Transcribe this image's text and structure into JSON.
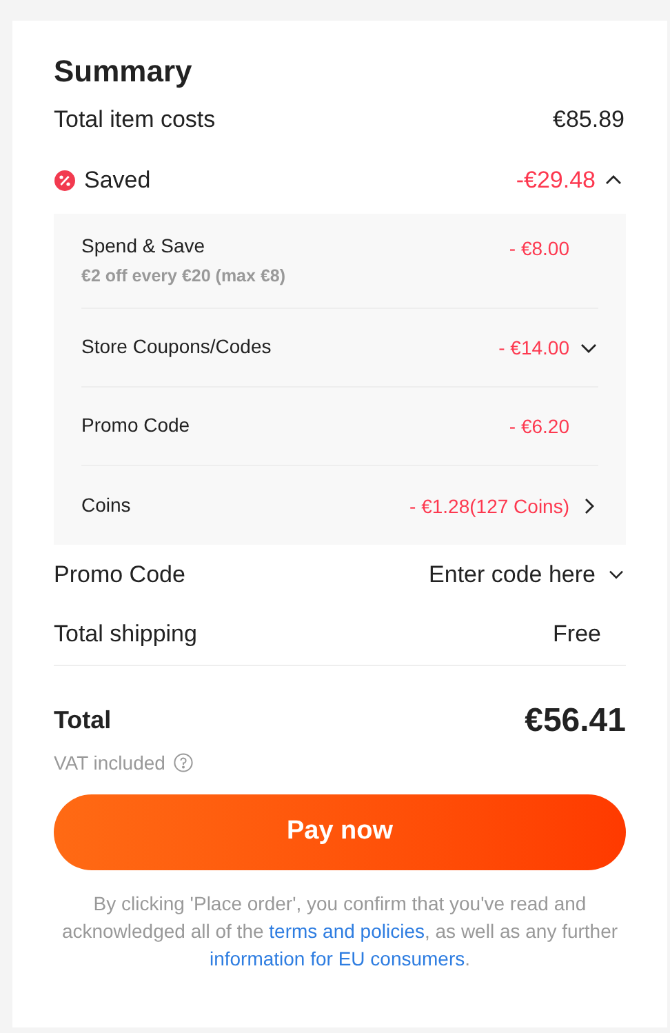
{
  "summary": {
    "title": "Summary",
    "item_costs": {
      "label": "Total item costs",
      "amount": "€85.89"
    },
    "saved": {
      "label": "Saved",
      "amount": "-€29.48",
      "expanded": true,
      "discounts": [
        {
          "label": "Spend & Save",
          "note": "€2 off every €20 (max €8)",
          "amount": "- €8.00",
          "kind": "plain"
        },
        {
          "label": "Store Coupons/Codes",
          "amount": "- €14.00",
          "kind": "dropdown"
        },
        {
          "label": "Promo Code",
          "amount": "- €6.20",
          "kind": "plain"
        },
        {
          "label": "Coins",
          "amount": "- €1.28(127 Coins)",
          "kind": "link"
        }
      ]
    },
    "promo_code": {
      "label": "Promo Code",
      "action": "Enter code here"
    },
    "shipping": {
      "label": "Total shipping",
      "amount": "Free"
    },
    "total": {
      "label": "Total",
      "amount": "€56.41",
      "vat_note": "VAT included"
    },
    "pay_button": "Pay now",
    "legal": {
      "before": "By clicking 'Place order', you confirm that you've read and acknowledged all of the",
      "link_1": "terms and policies",
      "middle": ", as well as any further",
      "link_2": "information for EU consumers",
      "after": "."
    }
  }
}
